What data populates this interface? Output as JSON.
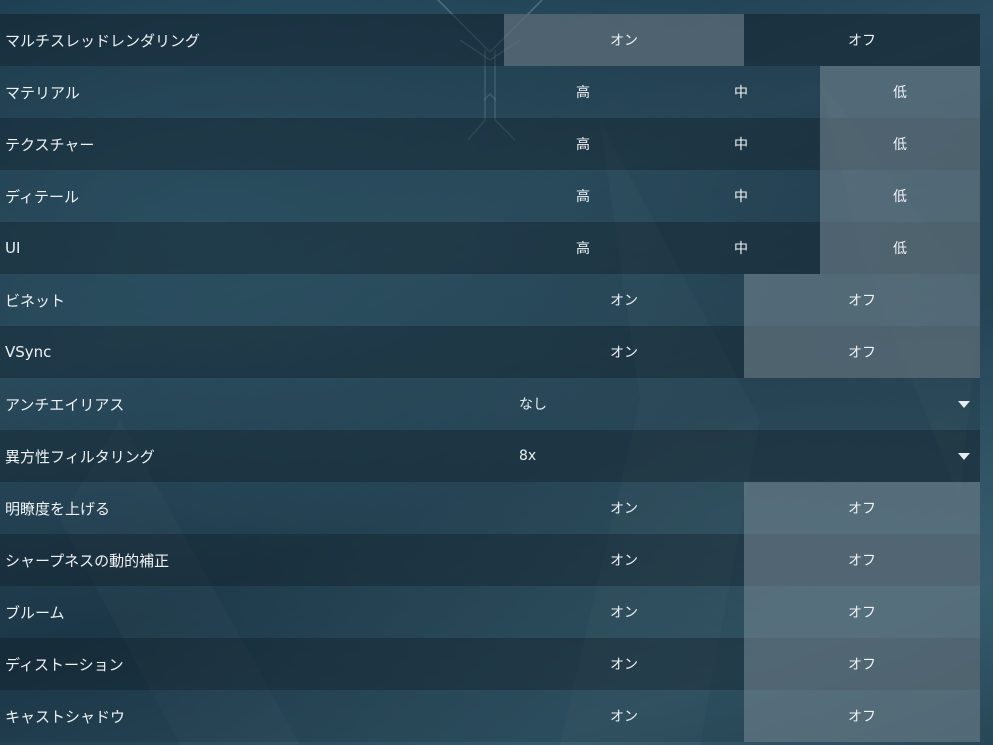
{
  "settings": [
    {
      "label": "マルチスレッドレンダリング",
      "type": "toggle",
      "options": [
        "オン",
        "オフ"
      ],
      "selected": 0
    },
    {
      "label": "マテリアル",
      "type": "triple",
      "options": [
        "高",
        "中",
        "低"
      ],
      "selected": 2
    },
    {
      "label": "テクスチャー",
      "type": "triple",
      "options": [
        "高",
        "中",
        "低"
      ],
      "selected": 2
    },
    {
      "label": "ディテール",
      "type": "triple",
      "options": [
        "高",
        "中",
        "低"
      ],
      "selected": 2
    },
    {
      "label": "UI",
      "type": "triple",
      "options": [
        "高",
        "中",
        "低"
      ],
      "selected": 2
    },
    {
      "label": "ビネット",
      "type": "toggle",
      "options": [
        "オン",
        "オフ"
      ],
      "selected": 1
    },
    {
      "label": "VSync",
      "type": "toggle",
      "options": [
        "オン",
        "オフ"
      ],
      "selected": 1
    },
    {
      "label": "アンチエイリアス",
      "type": "dropdown",
      "value": "なし"
    },
    {
      "label": "異方性フィルタリング",
      "type": "dropdown",
      "value": "8x"
    },
    {
      "label": "明瞭度を上げる",
      "type": "toggle",
      "options": [
        "オン",
        "オフ"
      ],
      "selected": 1
    },
    {
      "label": "シャープネスの動的補正",
      "type": "toggle",
      "options": [
        "オン",
        "オフ"
      ],
      "selected": 1
    },
    {
      "label": "ブルーム",
      "type": "toggle",
      "options": [
        "オン",
        "オフ"
      ],
      "selected": 1
    },
    {
      "label": "ディストーション",
      "type": "toggle",
      "options": [
        "オン",
        "オフ"
      ],
      "selected": 1
    },
    {
      "label": "キャストシャドウ",
      "type": "toggle",
      "options": [
        "オン",
        "オフ"
      ],
      "selected": 1
    }
  ],
  "icons": {
    "dropdown": "caret-down-icon"
  },
  "colors": {
    "selected": "#788a96",
    "background": "#1d3a4b"
  }
}
